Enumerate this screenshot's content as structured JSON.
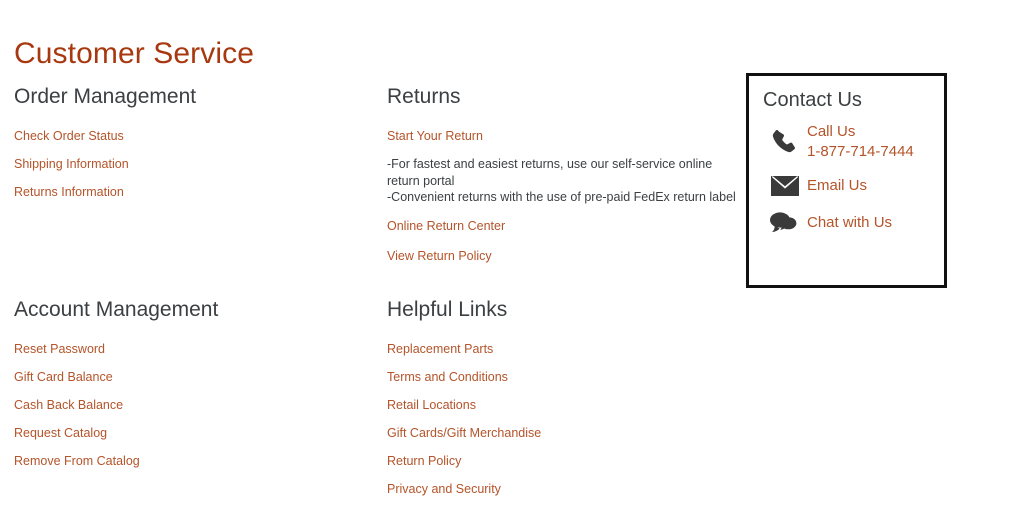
{
  "page": {
    "title": "Customer Service",
    "title_color": "#a8380f",
    "link_color": "#b4542a",
    "heading_color": "#3c4043",
    "body_color": "#3c4043",
    "background": "#ffffff"
  },
  "sections": {
    "order_management": {
      "heading": "Order Management",
      "links": [
        "Check Order Status",
        "Shipping Information",
        "Returns Information"
      ]
    },
    "returns": {
      "heading": "Returns",
      "start_link": "Start Your Return",
      "body_lines": [
        "-For fastest and easiest returns, use our self-service online return portal",
        "-Convenient returns with the use of pre-paid FedEx return label"
      ],
      "online_return_center": "Online Return Center",
      "view_return_policy": "View Return Policy"
    },
    "account_management": {
      "heading": "Account Management",
      "links": [
        "Reset Password",
        "Gift Card Balance",
        "Cash Back Balance",
        "Request Catalog",
        "Remove From Catalog"
      ]
    },
    "helpful_links": {
      "heading": "Helpful Links",
      "links": [
        "Replacement Parts",
        "Terms and Conditions",
        "Retail Locations",
        "Gift Cards/Gift Merchandise",
        "Return Policy",
        "Privacy and Security"
      ]
    }
  },
  "contact": {
    "title": "Contact Us",
    "border_color": "#111111",
    "icon_color": "#3a3a3a",
    "call": {
      "icon": "phone-icon",
      "label": "Call Us",
      "phone": "1-877-714-7444"
    },
    "email": {
      "icon": "envelope-icon",
      "label": "Email Us"
    },
    "chat": {
      "icon": "chat-bubbles-icon",
      "label": "Chat with Us"
    }
  }
}
